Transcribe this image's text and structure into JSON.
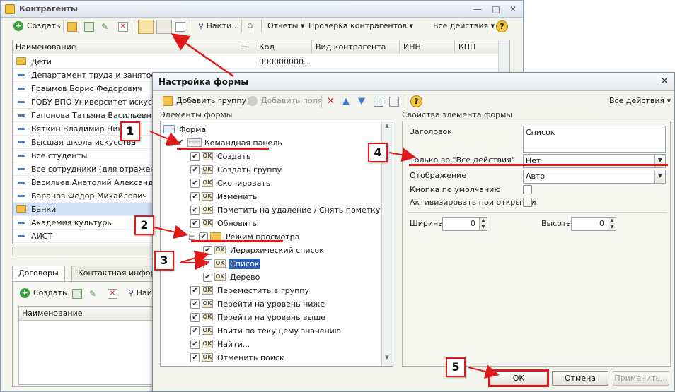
{
  "back_window": {
    "title": "Контрагенты",
    "toolbar": {
      "create": "Создать",
      "find": "Найти...",
      "reports": "Отчеты",
      "check": "Проверка контрагентов",
      "all_actions": "Все действия",
      "help": "?"
    },
    "columns": [
      "Наименование",
      "Код",
      "Вид контрагента",
      "ИНН",
      "КПП"
    ],
    "rows": [
      {
        "name": "Дети",
        "code": "000000000...",
        "kind": "folder"
      },
      {
        "name": "Департамент труда и занятости н",
        "code": "",
        "kind": "item"
      },
      {
        "name": "Граымов Борис Федорович",
        "code": "",
        "kind": "item"
      },
      {
        "name": "ГОБУ ВПО Университет искусств",
        "code": "",
        "kind": "item"
      },
      {
        "name": "Гапонова Татьяна Васильевна",
        "code": "",
        "kind": "item"
      },
      {
        "name": "Вяткин Владимир Никол",
        "code": "",
        "kind": "item"
      },
      {
        "name": "Высшая школа искусства",
        "code": "",
        "kind": "item"
      },
      {
        "name": "Все студенты",
        "code": "",
        "kind": "item"
      },
      {
        "name": "Все сотрудники (для отражения з",
        "code": "",
        "kind": "item"
      },
      {
        "name": "Васильев Анатолий Александров",
        "code": "",
        "kind": "item"
      },
      {
        "name": "Баранов Федор Михайлович",
        "code": "",
        "kind": "item"
      },
      {
        "name": "Банки",
        "code": "",
        "kind": "folder"
      },
      {
        "name": "Академия культуры",
        "code": "",
        "kind": "item"
      },
      {
        "name": "АИСТ",
        "code": "",
        "kind": "item"
      }
    ],
    "tabs": [
      "Договоры",
      "Контактная информ"
    ],
    "sub_toolbar": {
      "create": "Создать",
      "find": "Най"
    },
    "sub_column": "Наименование"
  },
  "dialog": {
    "title": "Настройка формы",
    "close": "✕",
    "toolbar": {
      "add_group": "Добавить группу",
      "add_fields": "Добавить поля",
      "all_actions": "Все действия",
      "help": "?"
    },
    "left_section": "Элементы формы",
    "right_section": "Свойства элемента формы",
    "tree": [
      {
        "label": "Форма",
        "level": 0,
        "type": "form",
        "checked": null
      },
      {
        "label": "Командная панель",
        "level": 1,
        "type": "panel",
        "checked": true,
        "expander": "−"
      },
      {
        "label": "Создать",
        "level": 2,
        "type": "ok",
        "checked": true
      },
      {
        "label": "Создать группу",
        "level": 2,
        "type": "ok",
        "checked": true
      },
      {
        "label": "Скопировать",
        "level": 2,
        "type": "ok",
        "checked": true
      },
      {
        "label": "Изменить",
        "level": 2,
        "type": "ok",
        "checked": true
      },
      {
        "label": "Пометить на удаление / Снять пометку",
        "level": 2,
        "type": "ok",
        "checked": true
      },
      {
        "label": "Обновить",
        "level": 2,
        "type": "ok",
        "checked": true
      },
      {
        "label": "Режим просмотра",
        "level": 2,
        "type": "folder",
        "checked": true,
        "expander": "−"
      },
      {
        "label": "Иерархический список",
        "level": 3,
        "type": "ok",
        "checked": true
      },
      {
        "label": "Список",
        "level": 3,
        "type": "ok",
        "checked": true,
        "selected": true
      },
      {
        "label": "Дерево",
        "level": 3,
        "type": "ok",
        "checked": true
      },
      {
        "label": "Переместить в группу",
        "level": 2,
        "type": "ok",
        "checked": true
      },
      {
        "label": "Перейти на уровень ниже",
        "level": 2,
        "type": "ok",
        "checked": true
      },
      {
        "label": "Перейти на уровень выше",
        "level": 2,
        "type": "ok",
        "checked": true
      },
      {
        "label": "Найти по текущему значению",
        "level": 2,
        "type": "ok",
        "checked": true
      },
      {
        "label": "Найти...",
        "level": 2,
        "type": "ok",
        "checked": true
      },
      {
        "label": "Отменить поиск",
        "level": 2,
        "type": "ok",
        "checked": true
      }
    ],
    "ok_icon_text": "OK",
    "properties": {
      "header_label": "Заголовок",
      "header_value": "Список",
      "only_all_actions_label": "Только во \"Все действия\"",
      "only_all_actions_value": "Нет",
      "display_label": "Отображение",
      "display_value": "Авто",
      "default_button_label": "Кнопка по умолчанию",
      "activate_on_open_label": "Активизировать при открытии",
      "width_label": "Ширина",
      "width_value": "0",
      "height_label": "Высота",
      "height_value": "0"
    },
    "buttons": {
      "ok": "ОК",
      "cancel": "Отмена",
      "apply": "Применить..."
    }
  },
  "callouts": [
    "1",
    "2",
    "3",
    "4",
    "5"
  ],
  "colors": {
    "annotation_red": "#e01818",
    "selection_blue": "#2f5fb3"
  }
}
